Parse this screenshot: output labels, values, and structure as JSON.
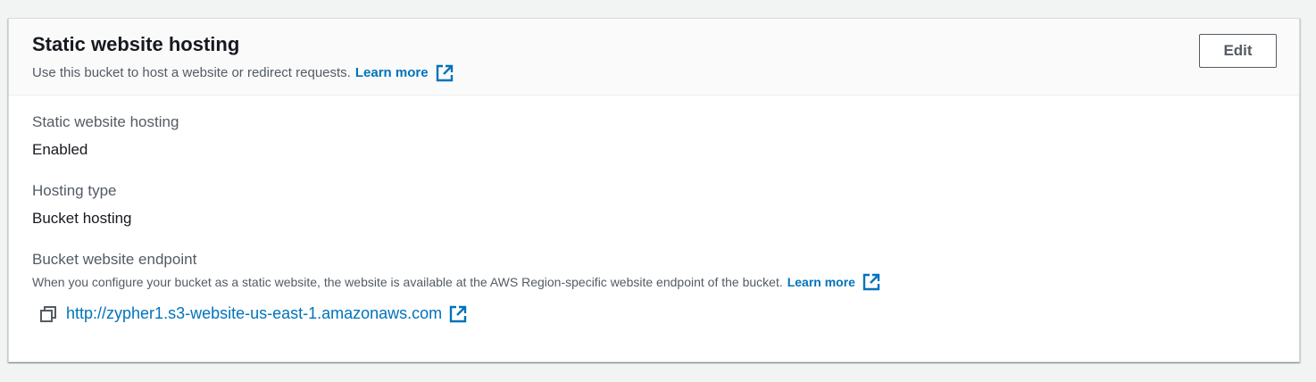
{
  "panel": {
    "title": "Static website hosting",
    "description": "Use this bucket to host a website or redirect requests.",
    "learn_more_label": "Learn more",
    "edit_label": "Edit"
  },
  "fields": {
    "hosting": {
      "label": "Static website hosting",
      "value": "Enabled"
    },
    "hosting_type": {
      "label": "Hosting type",
      "value": "Bucket hosting"
    },
    "endpoint": {
      "label": "Bucket website endpoint",
      "description": "When you configure your bucket as a static website, the website is available at the AWS Region-specific website endpoint of the bucket.",
      "learn_more_label": "Learn more",
      "url": "http://zypher1.s3-website-us-east-1.amazonaws.com"
    }
  },
  "icons": {
    "external_link": "external-link-icon",
    "copy": "copy-icon"
  },
  "colors": {
    "link": "#0073bb",
    "text_primary": "#16191f",
    "text_secondary": "#545b64"
  }
}
